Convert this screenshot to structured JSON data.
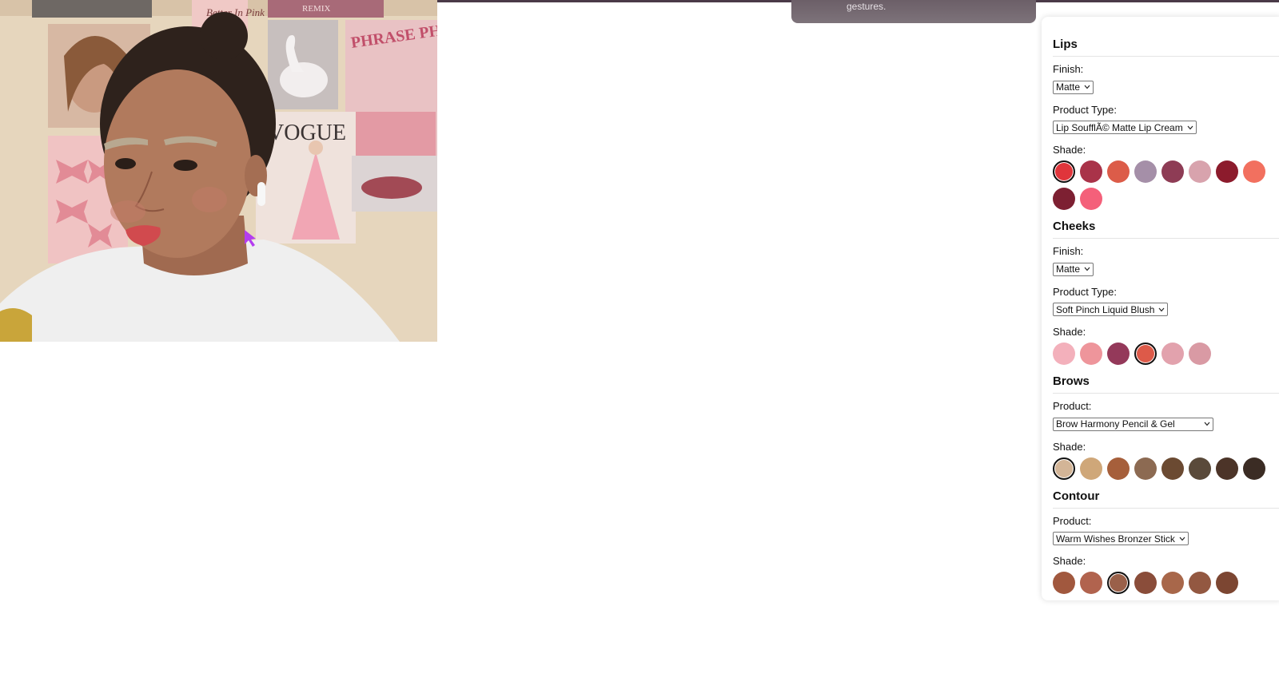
{
  "toast": {
    "text": "gestures."
  },
  "camera": {
    "posters": {
      "top_center": "REMIX",
      "top_mid": "Better In Pink",
      "vogue": "VOGUE",
      "phrase": "PHRASE PHRASE PHRASE"
    }
  },
  "lips": {
    "title": "Lips",
    "finish_label": "Finish:",
    "finish_value": "Matte",
    "product_type_label": "Product Type:",
    "product_type_value": "Lip SoufflÃ© Matte Lip Cream",
    "shade_label": "Shade:",
    "shades": [
      "#e0353b",
      "#a93349",
      "#dc5c49",
      "#a58fa8",
      "#8e3c55",
      "#d8a3ad",
      "#8c1b2c",
      "#f2705f",
      "#7d2032",
      "#f4607a"
    ],
    "selected_index": 0
  },
  "cheeks": {
    "title": "Cheeks",
    "finish_label": "Finish:",
    "finish_value": "Matte",
    "product_type_label": "Product Type:",
    "product_type_value": "Soft Pinch Liquid Blush",
    "shade_label": "Shade:",
    "shades": [
      "#f3b0bb",
      "#ee959b",
      "#94395a",
      "#dd5a49",
      "#e2a2ad",
      "#d99aa4"
    ],
    "selected_index": 3
  },
  "brows": {
    "title": "Brows",
    "product_label": "Product:",
    "product_value": "Brow Harmony Pencil & Gel",
    "shade_label": "Shade:",
    "shades": [
      "#d3b597",
      "#cfa779",
      "#a65f3b",
      "#8c6a52",
      "#6b4a32",
      "#5a4a3a",
      "#4c3428",
      "#3b2c24"
    ],
    "selected_index": 0
  },
  "contour": {
    "title": "Contour",
    "product_label": "Product:",
    "product_value": "Warm Wishes Bronzer Stick",
    "shade_label": "Shade:",
    "shades": [
      "#a1583e",
      "#b1634e",
      "#9a6049",
      "#8a4d3a",
      "#a8674a",
      "#935841",
      "#7c4632"
    ],
    "selected_index": 2
  }
}
